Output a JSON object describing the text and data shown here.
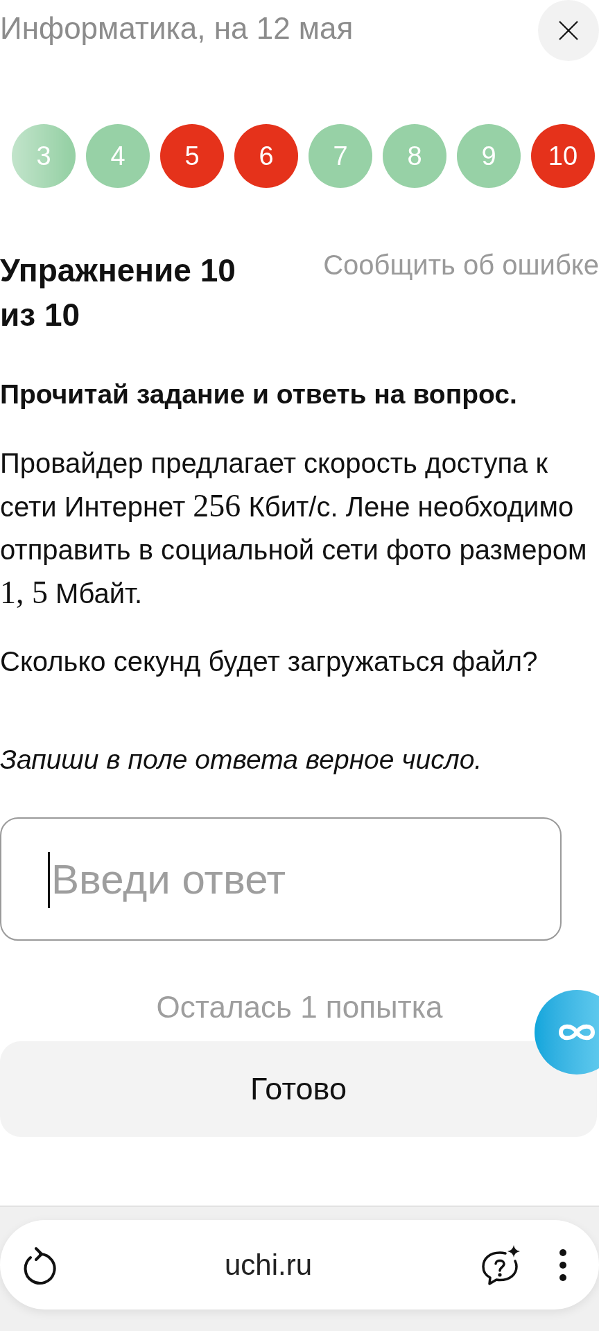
{
  "header": {
    "title": "Информатика, на 12 мая"
  },
  "progress": [
    {
      "label": "3",
      "color": "#97d1a6"
    },
    {
      "label": "4",
      "color": "#97d1a6"
    },
    {
      "label": "5",
      "color": "#e5321b"
    },
    {
      "label": "6",
      "color": "#e5321b"
    },
    {
      "label": "7",
      "color": "#97d1a6"
    },
    {
      "label": "8",
      "color": "#97d1a6"
    },
    {
      "label": "9",
      "color": "#97d1a6"
    },
    {
      "label": "10",
      "color": "#e5321b"
    }
  ],
  "exercise": {
    "title": "Упражнение 10 из 10",
    "report_link": "Сообщить об ошибке",
    "instruction": "Прочитай задание и ответь на вопрос.",
    "problem": [
      {
        "kind": "text",
        "text": "Провайдер предлагает скорость доступа к сети Интернет "
      },
      {
        "kind": "math",
        "text": "256"
      },
      {
        "kind": "text",
        "text": " Кбит/с. Лене необходимо отправить в социальной сети фото размером "
      },
      {
        "kind": "math",
        "text": "1, 5"
      },
      {
        "kind": "text",
        "text": " Мбайт."
      }
    ],
    "question": "Сколько секунд будет загружаться файл?",
    "hint": "Запиши в поле ответа верное число."
  },
  "answer_field": {
    "placeholder": "Введи ответ",
    "focused": true
  },
  "attempts_left": "Осталась 1 попытка",
  "submit_button": "Готово",
  "browser_bar": {
    "url": "uchi.ru"
  }
}
